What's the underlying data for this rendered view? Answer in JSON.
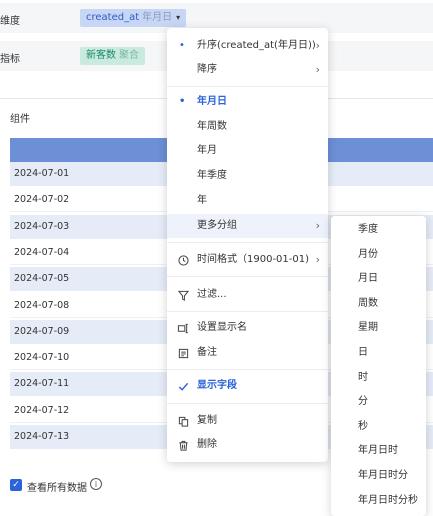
{
  "dimension_row": {
    "label": "维度",
    "field": "created_at",
    "granularity": "年月日",
    "caret": "▾"
  },
  "metric_row": {
    "label": "指标",
    "field": "新客数",
    "agg": "聚合"
  },
  "component": {
    "title": "组件"
  },
  "table": {
    "rows": [
      "2024-07-01",
      "2024-07-02",
      "2024-07-03",
      "2024-07-04",
      "2024-07-05",
      "2024-07-08",
      "2024-07-09",
      "2024-07-10",
      "2024-07-11",
      "2024-07-12",
      "2024-07-13"
    ]
  },
  "footer": {
    "show_all_label": "查看所有数据",
    "info": "i",
    "check": "✓"
  },
  "menu": {
    "sort_asc": "升序(created_at(年月日))",
    "sort_desc": "降序",
    "gran_day": "年月日",
    "gran_week": "年周数",
    "gran_month": "年月",
    "gran_quarter": "年季度",
    "gran_year": "年",
    "more_group": "更多分组",
    "time_format": "时间格式（1900-01-01)",
    "filter": "过滤...",
    "display_name": "设置显示名",
    "note": "备注",
    "show_field": "显示字段",
    "copy": "复制",
    "delete": "删除",
    "chevron": "›",
    "dot": "•"
  },
  "submenu": {
    "items": [
      "季度",
      "月份",
      "月日",
      "周数",
      "星期",
      "日",
      "时",
      "分",
      "秒",
      "年月日时",
      "年月日时分",
      "年月日时分秒"
    ]
  },
  "icons": {
    "clock": "clock-icon",
    "filter": "filter-icon",
    "rename": "rename-icon",
    "note": "note-icon",
    "check": "check-icon",
    "copy": "copy-icon",
    "delete": "trash-icon"
  },
  "colors": {
    "accent": "#2b63d9",
    "header": "#6d8fd6",
    "row_alt": "#e6ecf7"
  }
}
